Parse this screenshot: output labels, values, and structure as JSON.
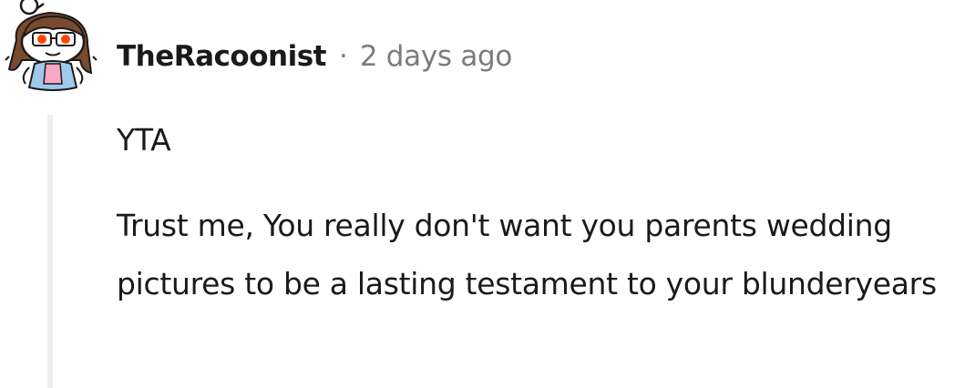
{
  "comment": {
    "avatar_icon": "reddit-snoo-avatar-girl-glasses-icon",
    "username": "TheRacoonist",
    "separator": "·",
    "timestamp": "2 days ago",
    "paragraphs": [
      "YTA",
      "Trust me, You really don't want you parents wedding pictures to be a lasting testament to your blunderyears"
    ]
  },
  "colors": {
    "text": "#1a1a1b",
    "meta": "#7c7c7c",
    "thread_line": "#edeff1"
  }
}
